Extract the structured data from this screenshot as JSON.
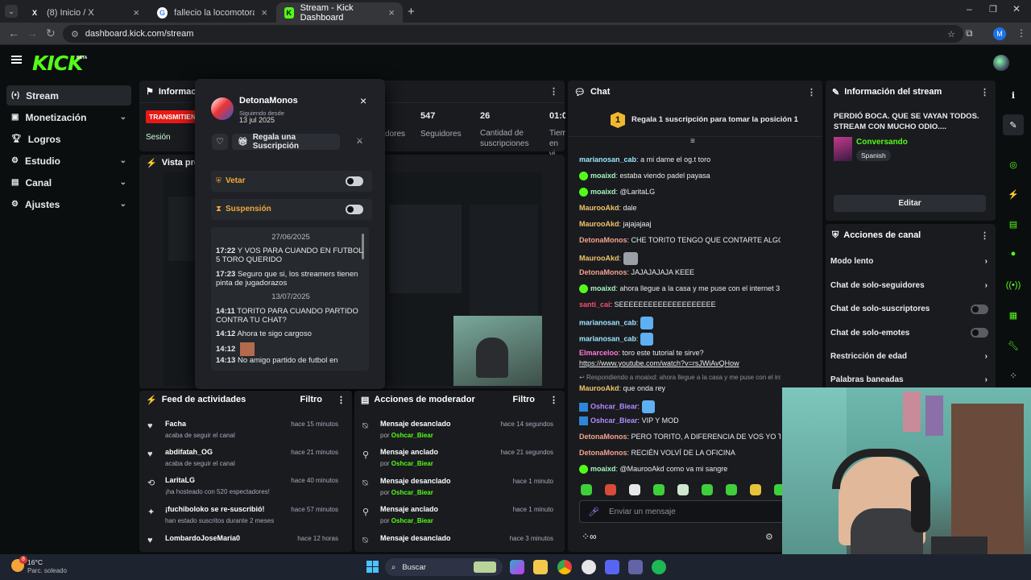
{
  "browser": {
    "tabs": [
      {
        "title": "(8) Inicio / X",
        "icon": "x-logo-icon"
      },
      {
        "title": "fallecio la locomotora - Buscar",
        "icon": "google-icon"
      },
      {
        "title": "Stream - Kick Dashboard",
        "icon": "kick-icon"
      }
    ],
    "url": "dashboard.kick.com/stream",
    "profile_initial": "M"
  },
  "brand": {
    "logo": "KICK",
    "beta": "BETA",
    "accent": "#53fc18"
  },
  "sidebar": {
    "items": [
      {
        "label": "Stream",
        "icon": "broadcast-icon"
      },
      {
        "label": "Monetización",
        "icon": "money-icon"
      },
      {
        "label": "Logros",
        "icon": "trophy-icon"
      },
      {
        "label": "Estudio",
        "icon": "studio-icon"
      },
      {
        "label": "Canal",
        "icon": "channel-icon"
      },
      {
        "label": "Ajustes",
        "icon": "gear-icon"
      }
    ]
  },
  "session": {
    "title": "Informac",
    "status": "TRANSMITIEN",
    "session_label": "Sesión",
    "stats": [
      {
        "value": "",
        "label": "dores"
      },
      {
        "value": "547",
        "label": "Seguidores"
      },
      {
        "value": "26",
        "label": "Cantidad de suscripciones"
      },
      {
        "value": "01:0",
        "label": "Tiem en vi"
      }
    ],
    "preview_label": "Vista previ"
  },
  "user_card": {
    "name": "DetonaMonos",
    "following_label": "Siguiendo desde",
    "following_date": "13 jul 2025",
    "gift_button": "Regala una Suscripción",
    "ban_label": "Vetar",
    "suspend_label": "Suspensión",
    "history": [
      {
        "type": "date",
        "text": "27/06/2025"
      },
      {
        "type": "msg",
        "time": "17:22",
        "text": "Y VOS PARA CUANDO EN FUTBOL 5 TORO QUERIDO"
      },
      {
        "type": "msg",
        "time": "17:23",
        "text": "Seguro que si, los streamers tienen pinta de jugadorazos"
      },
      {
        "type": "date",
        "text": "13/07/2025"
      },
      {
        "type": "msg",
        "time": "14:11",
        "text": "TORITO PARA CUANDO PARTIDO CONTRA TU CHAT?"
      },
      {
        "type": "msg",
        "time": "14:12",
        "text": "Ahora te sigo cargoso"
      },
      {
        "type": "msg",
        "time": "14:12",
        "text": ""
      },
      {
        "type": "msg",
        "time": "14:13",
        "text": "No amigo partido de futbol en"
      }
    ]
  },
  "chat": {
    "title": "Chat",
    "pinned": "Regala 1 suscripción para tomar la posición 1",
    "pinned_rank": "1",
    "messages": [
      {
        "user": "marianosan_cab",
        "color": "#9ee6ff",
        "badge": false,
        "text": "a mi dame el og.t toro"
      },
      {
        "user": "moaixd",
        "color": "#a5f3c0",
        "badge": true,
        "text": "estaba viendo padel payasa"
      },
      {
        "user": "moaixd",
        "color": "#a5f3c0",
        "badge": true,
        "text": "@LaritaLG"
      },
      {
        "user": "MaurooAkd",
        "color": "#f2c46a",
        "badge": false,
        "text": "dale"
      },
      {
        "user": "MaurooAkd",
        "color": "#f2c46a",
        "badge": false,
        "text": "jajajajaaj"
      },
      {
        "user": "DetonaMonos",
        "color": "#f4a28c",
        "badge": false,
        "text": "CHE TORITO TENGO QUE CONTARTE ALGO"
      },
      {
        "user": "MaurooAkd",
        "color": "#f2c46a",
        "badge": false,
        "text": ""
      },
      {
        "user": "DetonaMonos",
        "color": "#f4a28c",
        "badge": false,
        "text": "JAJAJAJAJA KEEE"
      },
      {
        "user": "moaixd",
        "color": "#a5f3c0",
        "badge": true,
        "text": "ahora llegue a la casa y me puse con el internet 3 megas"
      },
      {
        "user": "santi_cai",
        "color": "#ff4e6b",
        "badge": false,
        "text": "SEEEEEEEEEEEEEEEEEEEE"
      },
      {
        "user": "marianosan_cab",
        "color": "#9ee6ff",
        "badge": false,
        "text": ""
      },
      {
        "user": "marianosan_cab",
        "color": "#9ee6ff",
        "badge": false,
        "text": ""
      },
      {
        "user": "Elmarceloo",
        "color": "#ff7ad9",
        "badge": false,
        "text": "toro este tutorial te sirve?"
      },
      {
        "user": "",
        "color": "#fff",
        "badge": false,
        "text": "https://www.youtube.com/watch?v=rsJWiAvQHow"
      },
      {
        "user": "",
        "color": "#9aa",
        "badge": false,
        "text": "Respondiendo a moaixd: ahora llegue a la casa y me puse con el inter..."
      },
      {
        "user": "MaurooAkd",
        "color": "#f2c46a",
        "badge": false,
        "text": "que onda rey"
      },
      {
        "user": "Oshcar_Biear",
        "color": "#b58bff",
        "badge": false,
        "text": ""
      },
      {
        "user": "Oshcar_Biear",
        "color": "#b58bff",
        "badge": false,
        "text": "VIP Y MOD"
      },
      {
        "user": "DetonaMonos",
        "color": "#f4a28c",
        "badge": false,
        "text": "PERO TORITO, A DIFERENCIA DE VOS YO TRA"
      },
      {
        "user": "DetonaMonos",
        "color": "#f4a28c",
        "badge": false,
        "text": "RECIÉN VOLVÍ DE LA OFICINA"
      },
      {
        "user": "moaixd",
        "color": "#a5f3c0",
        "badge": true,
        "text": "@MaurooAkd como va mi sangre"
      }
    ],
    "input_placeholder": "Enviar un mensaje"
  },
  "stream_info": {
    "title": "Información del stream",
    "stream_title": "PERDIÓ BOCA. QUE SE VAYAN TODOS. STREAM CON MUCHO ODIO....",
    "category": "Conversando",
    "language": "Spanish",
    "edit_button": "Editar"
  },
  "channel_actions": {
    "title": "Acciones de canal",
    "items": [
      {
        "label": "Modo lento",
        "control": "chevron"
      },
      {
        "label": "Chat de solo-seguidores",
        "control": "chevron"
      },
      {
        "label": "Chat de solo-suscriptores",
        "control": "toggle"
      },
      {
        "label": "Chat de solo-emotes",
        "control": "toggle"
      },
      {
        "label": "Restricción de edad",
        "control": "chevron"
      },
      {
        "label": "Palabras baneadas",
        "control": "chevron"
      }
    ]
  },
  "activity_feed": {
    "title": "Feed de actividades",
    "filter": "Filtro",
    "items": [
      {
        "name": "Facha",
        "detail": "acaba de seguir el canal",
        "time": "hace 15 minutos",
        "icon": "heart-icon"
      },
      {
        "name": "abdifatah_OG",
        "detail": "acaba de seguir el canal",
        "time": "hace 21 minutos",
        "icon": "heart-icon"
      },
      {
        "name": "LaritaLG",
        "detail": "¡ha hosteado con 520 espectadores!",
        "time": "hace 40 minutos",
        "icon": "host-icon"
      },
      {
        "name": "¡fuchiboloko se re-suscribió!",
        "detail": "han estado suscritos durante 2 meses",
        "time": "hace 57 minutos",
        "icon": "sparkle-icon"
      },
      {
        "name": "LombardoJoseMaria0",
        "detail": "",
        "time": "hace 12 horas",
        "icon": "heart-icon"
      }
    ]
  },
  "mod_actions": {
    "title": "Acciones de moderador",
    "filter": "Filtro",
    "items": [
      {
        "action": "Mensaje desanclado",
        "by": "por",
        "mod": "Oshcar_Biear",
        "time": "hace 14 segundos",
        "icon": "unpin-icon"
      },
      {
        "action": "Mensaje anclado",
        "by": "por",
        "mod": "Oshcar_Biear",
        "time": "hace 21 segundos",
        "icon": "pin-icon"
      },
      {
        "action": "Mensaje desanclado",
        "by": "por",
        "mod": "Oshcar_Biear",
        "time": "hace 1 minuto",
        "icon": "unpin-icon"
      },
      {
        "action": "Mensaje anclado",
        "by": "por",
        "mod": "Oshcar_Biear",
        "time": "hace 1 minuto",
        "icon": "pin-icon"
      },
      {
        "action": "Mensaje desanclado",
        "by": "por",
        "mod": "",
        "time": "hace 3 minutos",
        "icon": "unpin-icon"
      }
    ]
  },
  "taskbar": {
    "weather_temp": "16°C",
    "weather_desc": "Parc. soleado",
    "weather_badge": "8",
    "search": "Buscar"
  }
}
